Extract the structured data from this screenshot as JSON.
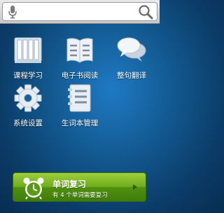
{
  "search": {
    "placeholder": "",
    "mic_icon": "microphone-icon",
    "search_icon": "magnifier-icon"
  },
  "apps": [
    {
      "label": "课程学习",
      "icon": "books-icon"
    },
    {
      "label": "电子书阅读",
      "icon": "open-book-icon"
    },
    {
      "label": "整句翻译",
      "icon": "speech-bubbles-icon"
    },
    {
      "label": "系统设置",
      "icon": "gear-icon"
    },
    {
      "label": "生词本管理",
      "icon": "notebook-icon"
    }
  ],
  "review": {
    "title": "单词复习",
    "subtitle": "有 4 个单词需要复习",
    "icon": "alarm-clock-icon"
  },
  "colors": {
    "background": "#12588f",
    "review_green": "#6fae1e",
    "icon_fill": "#e8eef4"
  }
}
